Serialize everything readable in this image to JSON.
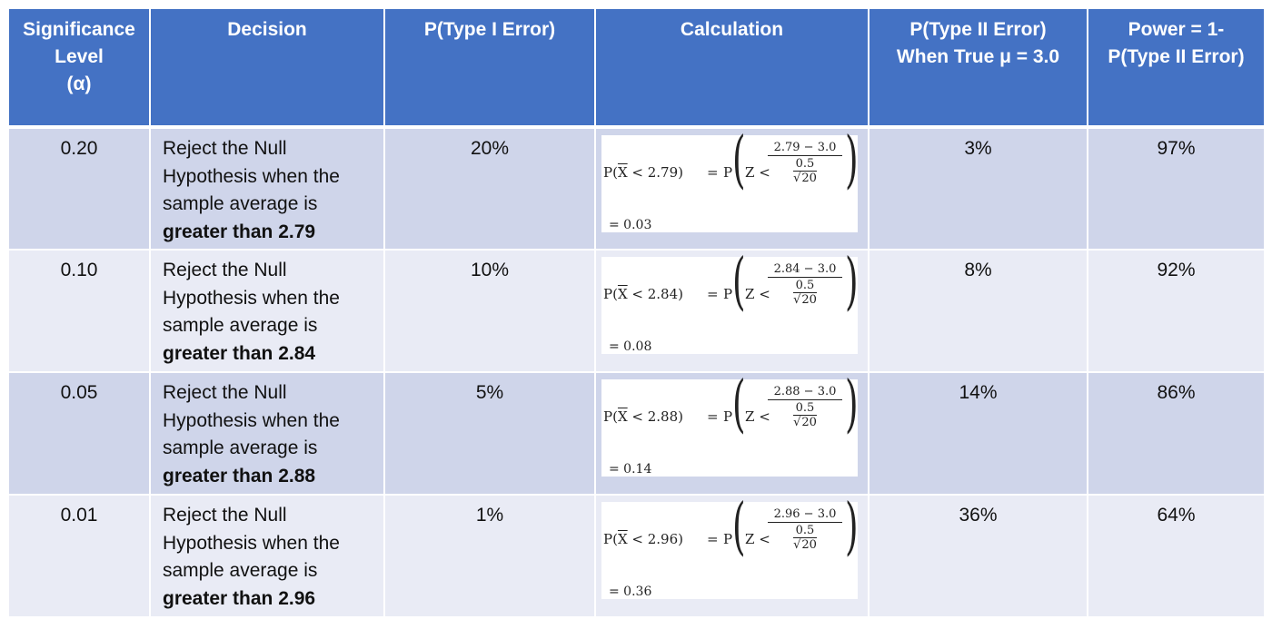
{
  "headers": {
    "significance": [
      "Significance",
      "Level",
      "(α)"
    ],
    "decision": [
      "Decision"
    ],
    "type1": [
      "P(Type I Error)"
    ],
    "calculation": [
      "Calculation"
    ],
    "type2": [
      "P(Type II Error)",
      "When True μ = 3.0"
    ],
    "power": [
      "Power = 1-",
      "P(Type II Error)"
    ]
  },
  "rows": [
    {
      "alpha": "0.20",
      "decision": [
        "Reject the Null",
        "Hypothesis when the",
        "sample average is"
      ],
      "decision_bold": "greater than 2.79",
      "type1": "20%",
      "calc": {
        "lhs_prefix": "P(",
        "xbar": "X",
        "lhs_ineq": " < 2.79)",
        "eq": "=",
        "rhs_P": "P",
        "z": "Z <",
        "num": "2.79 − 3.0",
        "den_top": "0.5",
        "den_bottom": "20",
        "result": "= 0.03"
      },
      "type2": "3%",
      "power": "97%"
    },
    {
      "alpha": "0.10",
      "decision": [
        "Reject the Null",
        "Hypothesis when the",
        "sample average is"
      ],
      "decision_bold": "greater than 2.84",
      "type1": "10%",
      "calc": {
        "lhs_prefix": "P(",
        "xbar": "X",
        "lhs_ineq": " < 2.84)",
        "eq": "=",
        "rhs_P": "P",
        "z": "Z <",
        "num": "2.84 − 3.0",
        "den_top": "0.5",
        "den_bottom": "20",
        "result": "= 0.08"
      },
      "type2": "8%",
      "power": "92%"
    },
    {
      "alpha": "0.05",
      "decision": [
        "Reject the Null",
        "Hypothesis when the",
        "sample average is"
      ],
      "decision_bold": "greater than 2.88",
      "type1": "5%",
      "calc": {
        "lhs_prefix": "P(",
        "xbar": "X",
        "lhs_ineq": " < 2.88)",
        "eq": "=",
        "rhs_P": "P",
        "z": "Z <",
        "num": "2.88 − 3.0",
        "den_top": "0.5",
        "den_bottom": "20",
        "result": "= 0.14"
      },
      "type2": "14%",
      "power": "86%"
    },
    {
      "alpha": "0.01",
      "decision": [
        "Reject the Null",
        "Hypothesis when the",
        "sample average is"
      ],
      "decision_bold": "greater than 2.96",
      "type1": "1%",
      "calc": {
        "lhs_prefix": "P(",
        "xbar": "X",
        "lhs_ineq": " < 2.96)",
        "eq": "=",
        "rhs_P": "P",
        "z": "Z <",
        "num": "2.96 − 3.0",
        "den_top": "0.5",
        "den_bottom": "20",
        "result": "= 0.36"
      },
      "type2": "36%",
      "power": "64%"
    }
  ],
  "colors": {
    "header_bg": "#4472c4",
    "row_odd_bg": "#cfd5ea",
    "row_even_bg": "#e9ebf5"
  }
}
